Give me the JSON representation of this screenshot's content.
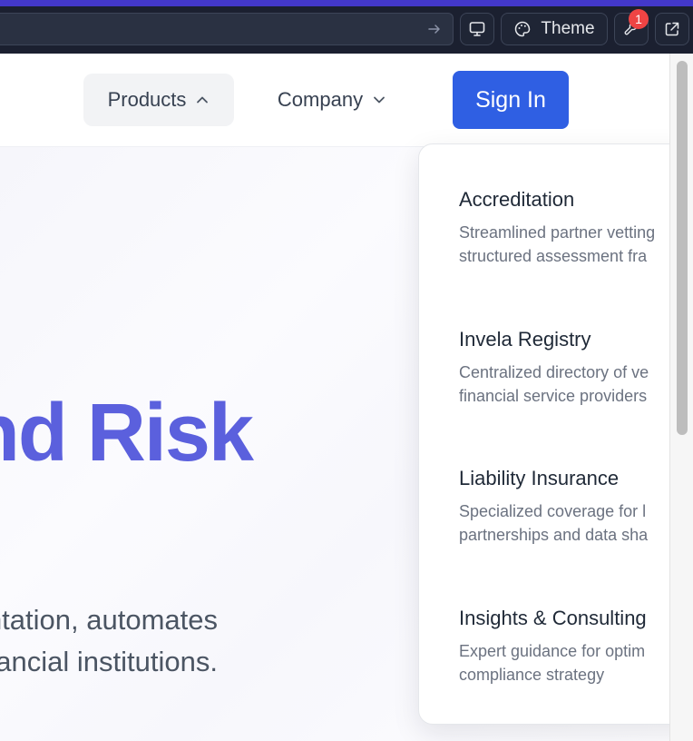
{
  "chrome": {
    "theme_label": "Theme",
    "tools_badge": "1",
    "icons": [
      "arrow-right-icon",
      "monitor-icon",
      "palette-icon",
      "wrench-icon",
      "external-link-icon"
    ]
  },
  "nav": {
    "products_label": "Products",
    "company_label": "Company",
    "signin_label": "Sign In"
  },
  "hero": {
    "title_fragment": "nd Risk",
    "subtitle_line1": "ntation, automates",
    "subtitle_line2": "financial institutions."
  },
  "products_menu": {
    "items": [
      {
        "title": "Accreditation",
        "desc_line1": "Streamlined partner vetting",
        "desc_line2": "structured assessment fra"
      },
      {
        "title": "Invela Registry",
        "desc_line1": "Centralized directory of ve",
        "desc_line2": "financial service providers"
      },
      {
        "title": "Liability Insurance",
        "desc_line1": "Specialized coverage for l",
        "desc_line2": "partnerships and data sha"
      },
      {
        "title": "Insights & Consulting",
        "desc_line1": "Expert guidance for optim",
        "desc_line2": "compliance strategy"
      }
    ]
  },
  "colors": {
    "accent": "#4338ca",
    "primary_button": "#2f5fe3",
    "hero_title": "#5b60dd",
    "badge": "#ef4444"
  }
}
